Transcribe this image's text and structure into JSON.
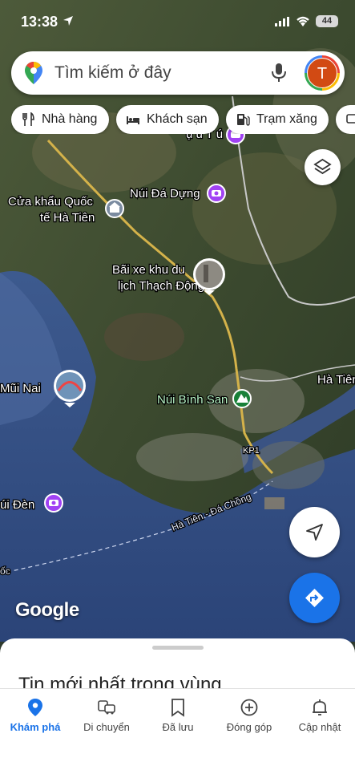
{
  "status_bar": {
    "time": "13:38",
    "battery": "44"
  },
  "search": {
    "placeholder": "Tìm kiếm ở đây",
    "avatar_letter": "T"
  },
  "chips": [
    {
      "label": "Nhà hàng",
      "icon": "restaurant-icon"
    },
    {
      "label": "Khách sạn",
      "icon": "hotel-icon"
    },
    {
      "label": "Trạm xăng",
      "icon": "gas-station-icon"
    }
  ],
  "map": {
    "labels": {
      "cua_khau_1": "Cửa khẩu Quốc",
      "cua_khau_2": "tế Hà Tiên",
      "nui_da_dung": "Núi Đá Dựng",
      "bai_xe_1": "Bãi xe khu du",
      "bai_xe_2": "lịch Thạch Động",
      "mui_nai": "Mũi Nai",
      "ha_tien": "Hà Tiên",
      "nui_binh_san": "Núi Bình San",
      "kp1": "KP1",
      "nui_den": "úi Đèn",
      "ferry_route": "Hà Tiên - Đá Chồng",
      "ferry_left": "ốc",
      "top_cut": "ụ́ u T ú"
    }
  },
  "logo": "Google",
  "sheet": {
    "title": "Tin mới nhất trong vùng..."
  },
  "nav": [
    {
      "label": "Khám phá",
      "icon": "explore-pin-icon",
      "active": true
    },
    {
      "label": "Di chuyển",
      "icon": "commute-icon",
      "active": false
    },
    {
      "label": "Đã lưu",
      "icon": "bookmark-icon",
      "active": false
    },
    {
      "label": "Đóng góp",
      "icon": "add-circle-icon",
      "active": false
    },
    {
      "label": "Cập nhật",
      "icon": "bell-icon",
      "active": false
    }
  ],
  "colors": {
    "accent": "#1a73e8",
    "avatar_bg": "#d24a13",
    "photo_marker": "#a142f4",
    "park_marker": "#188038"
  }
}
